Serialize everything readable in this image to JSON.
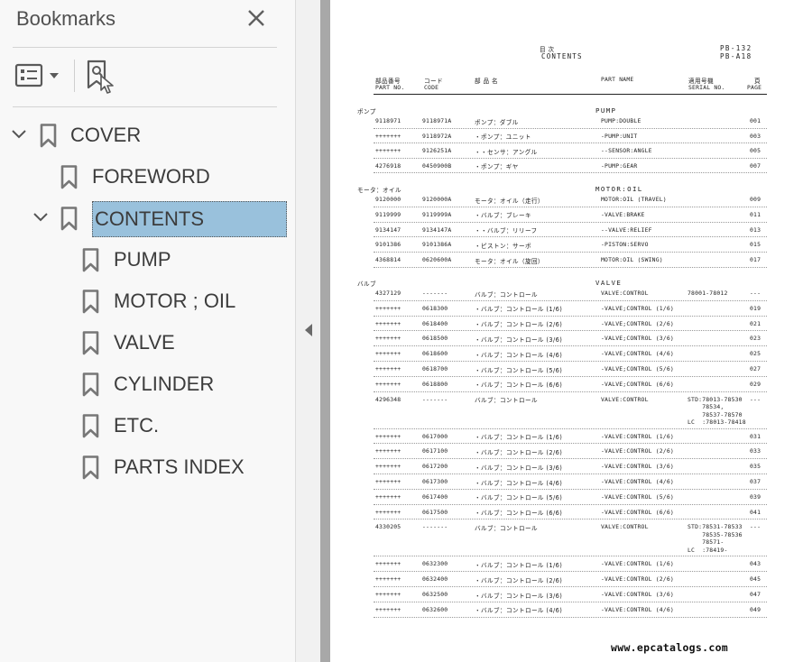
{
  "panel": {
    "title": "Bookmarks",
    "close_icon": "close-icon",
    "options_icon": "list-options-icon",
    "find_icon": "find-bookmark-icon"
  },
  "bookmarks": [
    {
      "label": "COVER",
      "level": 0,
      "expanded": true,
      "selected": false
    },
    {
      "label": "FOREWORD",
      "level": 1,
      "expanded": false,
      "selected": false
    },
    {
      "label": "CONTENTS",
      "level": 1,
      "expanded": true,
      "selected": true
    },
    {
      "label": "PUMP",
      "level": 2,
      "expanded": false,
      "selected": false
    },
    {
      "label": "MOTOR ; OIL",
      "level": 2,
      "expanded": false,
      "selected": false
    },
    {
      "label": "VALVE",
      "level": 2,
      "expanded": false,
      "selected": false
    },
    {
      "label": "CYLINDER",
      "level": 2,
      "expanded": false,
      "selected": false
    },
    {
      "label": "ETC.",
      "level": 2,
      "expanded": false,
      "selected": false
    },
    {
      "label": "PARTS INDEX",
      "level": 2,
      "expanded": false,
      "selected": false
    }
  ],
  "colors": {
    "selection": "#99c1dc",
    "panel_bg": "#f8f8f8",
    "text": "#3c3c3c"
  },
  "document": {
    "title_jp": "目      次",
    "title_en": "CONTENTS",
    "code1": "PB-132",
    "code2": "PB-A18",
    "headers": {
      "partno_jp": "部品番号",
      "partno_en": "PART NO.",
      "code_jp": "コード",
      "code_en": "CODE",
      "name_jp": "部 品 名",
      "partname_en": "PART NAME",
      "serial_jp": "適用号機",
      "serial_en": "SERIAL NO.",
      "page_jp": "頁",
      "page_en": "PAGE"
    },
    "sections": [
      {
        "jp": "ポンプ",
        "en": "PUMP",
        "rows": [
          {
            "part": "9118971",
            "code": "9118971A",
            "jp": "ポンプ：ダブル",
            "en": "PUMP:DOUBLE",
            "serial": "",
            "page": "001"
          },
          {
            "part": "+++++++",
            "code": "9118972A",
            "jp": "・ポンプ：ユニット",
            "en": "-PUMP:UNIT",
            "serial": "",
            "page": "003"
          },
          {
            "part": "+++++++",
            "code": "9126251A",
            "jp": "・・センサ：アングル",
            "en": "--SENSOR:ANGLE",
            "serial": "",
            "page": "005"
          },
          {
            "part": "4276918",
            "code": "0450900B",
            "jp": "・ポンプ：ギヤ",
            "en": "-PUMP:GEAR",
            "serial": "",
            "page": "007"
          }
        ]
      },
      {
        "jp": "モータ：オイル",
        "en": "MOTOR:OIL",
        "rows": [
          {
            "part": "9120000",
            "code": "9120000A",
            "jp": "モータ：オイル（走行）",
            "en": "MOTOR:OIL (TRAVEL)",
            "serial": "",
            "page": "009"
          },
          {
            "part": "9119999",
            "code": "9119999A",
            "jp": "・バルブ：ブレーキ",
            "en": "-VALVE:BRAKE",
            "serial": "",
            "page": "011"
          },
          {
            "part": "9134147",
            "code": "9134147A",
            "jp": "・・バルブ：リリーフ",
            "en": "--VALVE:RELIEF",
            "serial": "",
            "page": "013"
          },
          {
            "part": "9101386",
            "code": "9101386A",
            "jp": "・ピストン：サーボ",
            "en": "-PISTON:SERVO",
            "serial": "",
            "page": "015"
          },
          {
            "part": "4368814",
            "code": "0620600A",
            "jp": "モータ：オイル（旋回）",
            "en": "MOTOR:OIL (SWING)",
            "serial": "",
            "page": "017"
          }
        ]
      },
      {
        "jp": "バルブ",
        "en": "VALVE",
        "rows": [
          {
            "part": "4327129",
            "code": "-------",
            "jp": "バルブ：コントロール",
            "en": "VALVE:CONTROL",
            "serial": "78001-78012",
            "page": "---"
          },
          {
            "part": "+++++++",
            "code": "0618300",
            "jp": "・バルブ：コントロール (1/6)",
            "en": "-VALVE;CONTROL (1/6)",
            "serial": "",
            "page": "019"
          },
          {
            "part": "+++++++",
            "code": "0618400",
            "jp": "・バルブ：コントロール (2/6)",
            "en": "-VALVE;CONTROL (2/6)",
            "serial": "",
            "page": "021"
          },
          {
            "part": "+++++++",
            "code": "0618500",
            "jp": "・バルブ：コントロール (3/6)",
            "en": "-VALVE;CONTROL (3/6)",
            "serial": "",
            "page": "023"
          },
          {
            "part": "+++++++",
            "code": "0618600",
            "jp": "・バルブ：コントロール (4/6)",
            "en": "-VALVE;CONTROL (4/6)",
            "serial": "",
            "page": "025"
          },
          {
            "part": "+++++++",
            "code": "0618700",
            "jp": "・バルブ：コントロール (5/6)",
            "en": "-VALVE;CONTROL (5/6)",
            "serial": "",
            "page": "027"
          },
          {
            "part": "+++++++",
            "code": "0618800",
            "jp": "・バルブ：コントロール (6/6)",
            "en": "-VALVE;CONTROL (6/6)",
            "serial": "",
            "page": "029"
          },
          {
            "part": "4296348",
            "code": "-------",
            "jp": "バルブ：コントロール",
            "en": "VALVE:CONTROL",
            "serial": "STD:78013-78530\n    78534,\n    78537-78570\nLC  :78013-78418",
            "page": "---"
          },
          {
            "part": "+++++++",
            "code": "0617000",
            "jp": "・バルブ：コントロール (1/6)",
            "en": "-VALVE:CONTROL (1/6)",
            "serial": "",
            "page": "031"
          },
          {
            "part": "+++++++",
            "code": "0617100",
            "jp": "・バルブ：コントロール (2/6)",
            "en": "-VALVE:CONTROL (2/6)",
            "serial": "",
            "page": "033"
          },
          {
            "part": "+++++++",
            "code": "0617200",
            "jp": "・バルブ：コントロール (3/6)",
            "en": "-VALVE:CONTROL (3/6)",
            "serial": "",
            "page": "035"
          },
          {
            "part": "+++++++",
            "code": "0617300",
            "jp": "・バルブ：コントロール (4/6)",
            "en": "-VALVE:CONTROL (4/6)",
            "serial": "",
            "page": "037"
          },
          {
            "part": "+++++++",
            "code": "0617400",
            "jp": "・バルブ：コントロール (5/6)",
            "en": "-VALVE:CONTROL (5/6)",
            "serial": "",
            "page": "039"
          },
          {
            "part": "+++++++",
            "code": "0617500",
            "jp": "・バルブ：コントロール (6/6)",
            "en": "-VALVE:CONTROL (6/6)",
            "serial": "",
            "page": "041"
          },
          {
            "part": "4330205",
            "code": "-------",
            "jp": "バルブ：コントロール",
            "en": "VALVE:CONTROL",
            "serial": "STD:78531-78533\n    78535-78536\n    78571-\nLC  :78419-",
            "page": "---"
          },
          {
            "part": "+++++++",
            "code": "0632300",
            "jp": "・バルブ：コントロール (1/6)",
            "en": "-VALVE:CONTROL (1/6)",
            "serial": "",
            "page": "043"
          },
          {
            "part": "+++++++",
            "code": "0632400",
            "jp": "・バルブ：コントロール (2/6)",
            "en": "-VALVE:CONTROL (2/6)",
            "serial": "",
            "page": "045"
          },
          {
            "part": "+++++++",
            "code": "0632500",
            "jp": "・バルブ：コントロール (3/6)",
            "en": "-VALVE:CONTROL (3/6)",
            "serial": "",
            "page": "047"
          },
          {
            "part": "+++++++",
            "code": "0632600",
            "jp": "・バルブ：コントロール (4/6)",
            "en": "-VALVE:CONTROL (4/6)",
            "serial": "",
            "page": "049"
          }
        ]
      }
    ],
    "watermark": "www.epcatalogs.com"
  }
}
